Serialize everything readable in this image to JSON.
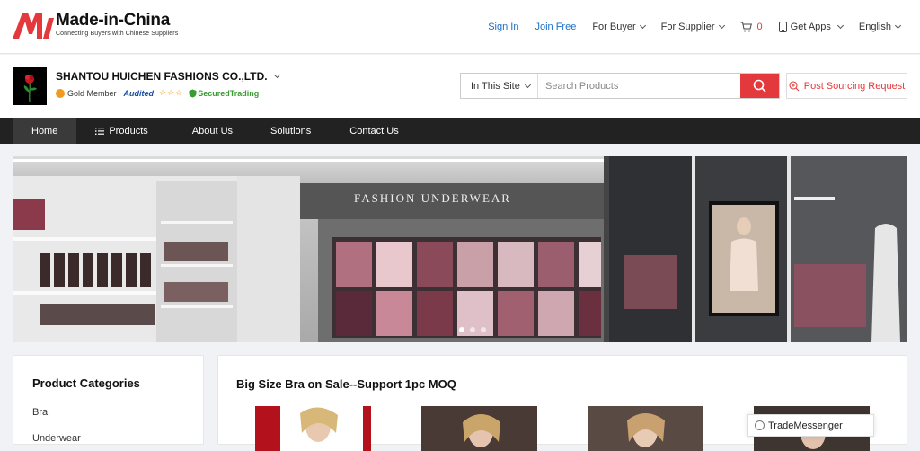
{
  "brand": {
    "name": "Made-in-China",
    "tagline": "Connecting Buyers with Chinese Suppliers",
    "color": "#e4393c"
  },
  "toplinks": {
    "sign_in": "Sign In",
    "join_free": "Join Free",
    "for_buyer": "For Buyer",
    "for_supplier": "For Supplier",
    "cart_count": "0",
    "get_apps": "Get Apps",
    "language": "English"
  },
  "company": {
    "name": "SHANTOU HUICHEN FASHIONS CO.,LTD.",
    "member": "Gold Member",
    "audited": "Audited",
    "secured": "SecuredTrading"
  },
  "search": {
    "scope": "In This Site",
    "placeholder": "Search Products",
    "post_sourcing": "Post Sourcing Request"
  },
  "nav": {
    "items": [
      "Home",
      "Products",
      "About Us",
      "Solutions",
      "Contact Us"
    ]
  },
  "categories": {
    "title": "Product Categories",
    "items": [
      "Bra",
      "Underwear"
    ]
  },
  "section": {
    "title": "Big Size Bra on Sale--Support 1pc MOQ"
  },
  "trade_messenger": "TradeMessenger",
  "banner": {
    "sign_text": "FASHION UNDERWEAR",
    "slide_count": 3,
    "active_slide": 1
  }
}
